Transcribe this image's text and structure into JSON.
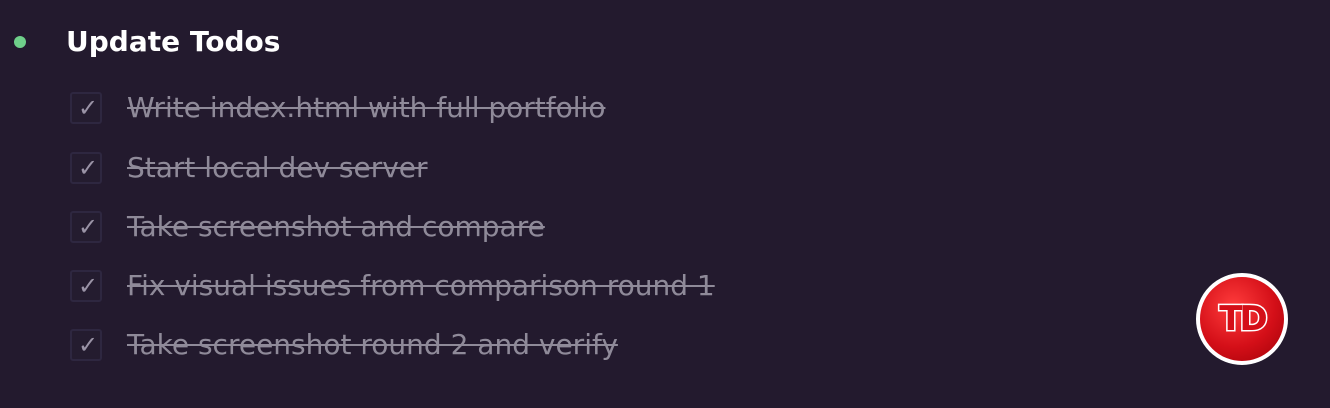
{
  "header": {
    "title": "Update Todos",
    "status_color": "#6fcf8a"
  },
  "todos": [
    {
      "label": "Write index.html with full portfolio",
      "checked": true,
      "check_glyph": "✓"
    },
    {
      "label": "Start local dev server",
      "checked": true,
      "check_glyph": "✓"
    },
    {
      "label": "Take screenshot and compare",
      "checked": true,
      "check_glyph": "✓"
    },
    {
      "label": "Fix visual issues from comparison round 1",
      "checked": true,
      "check_glyph": "✓"
    },
    {
      "label": "Take screenshot round 2 and verify",
      "checked": true,
      "check_glyph": "✓"
    }
  ],
  "logo": {
    "text": "TD",
    "color": "#d40f18"
  }
}
